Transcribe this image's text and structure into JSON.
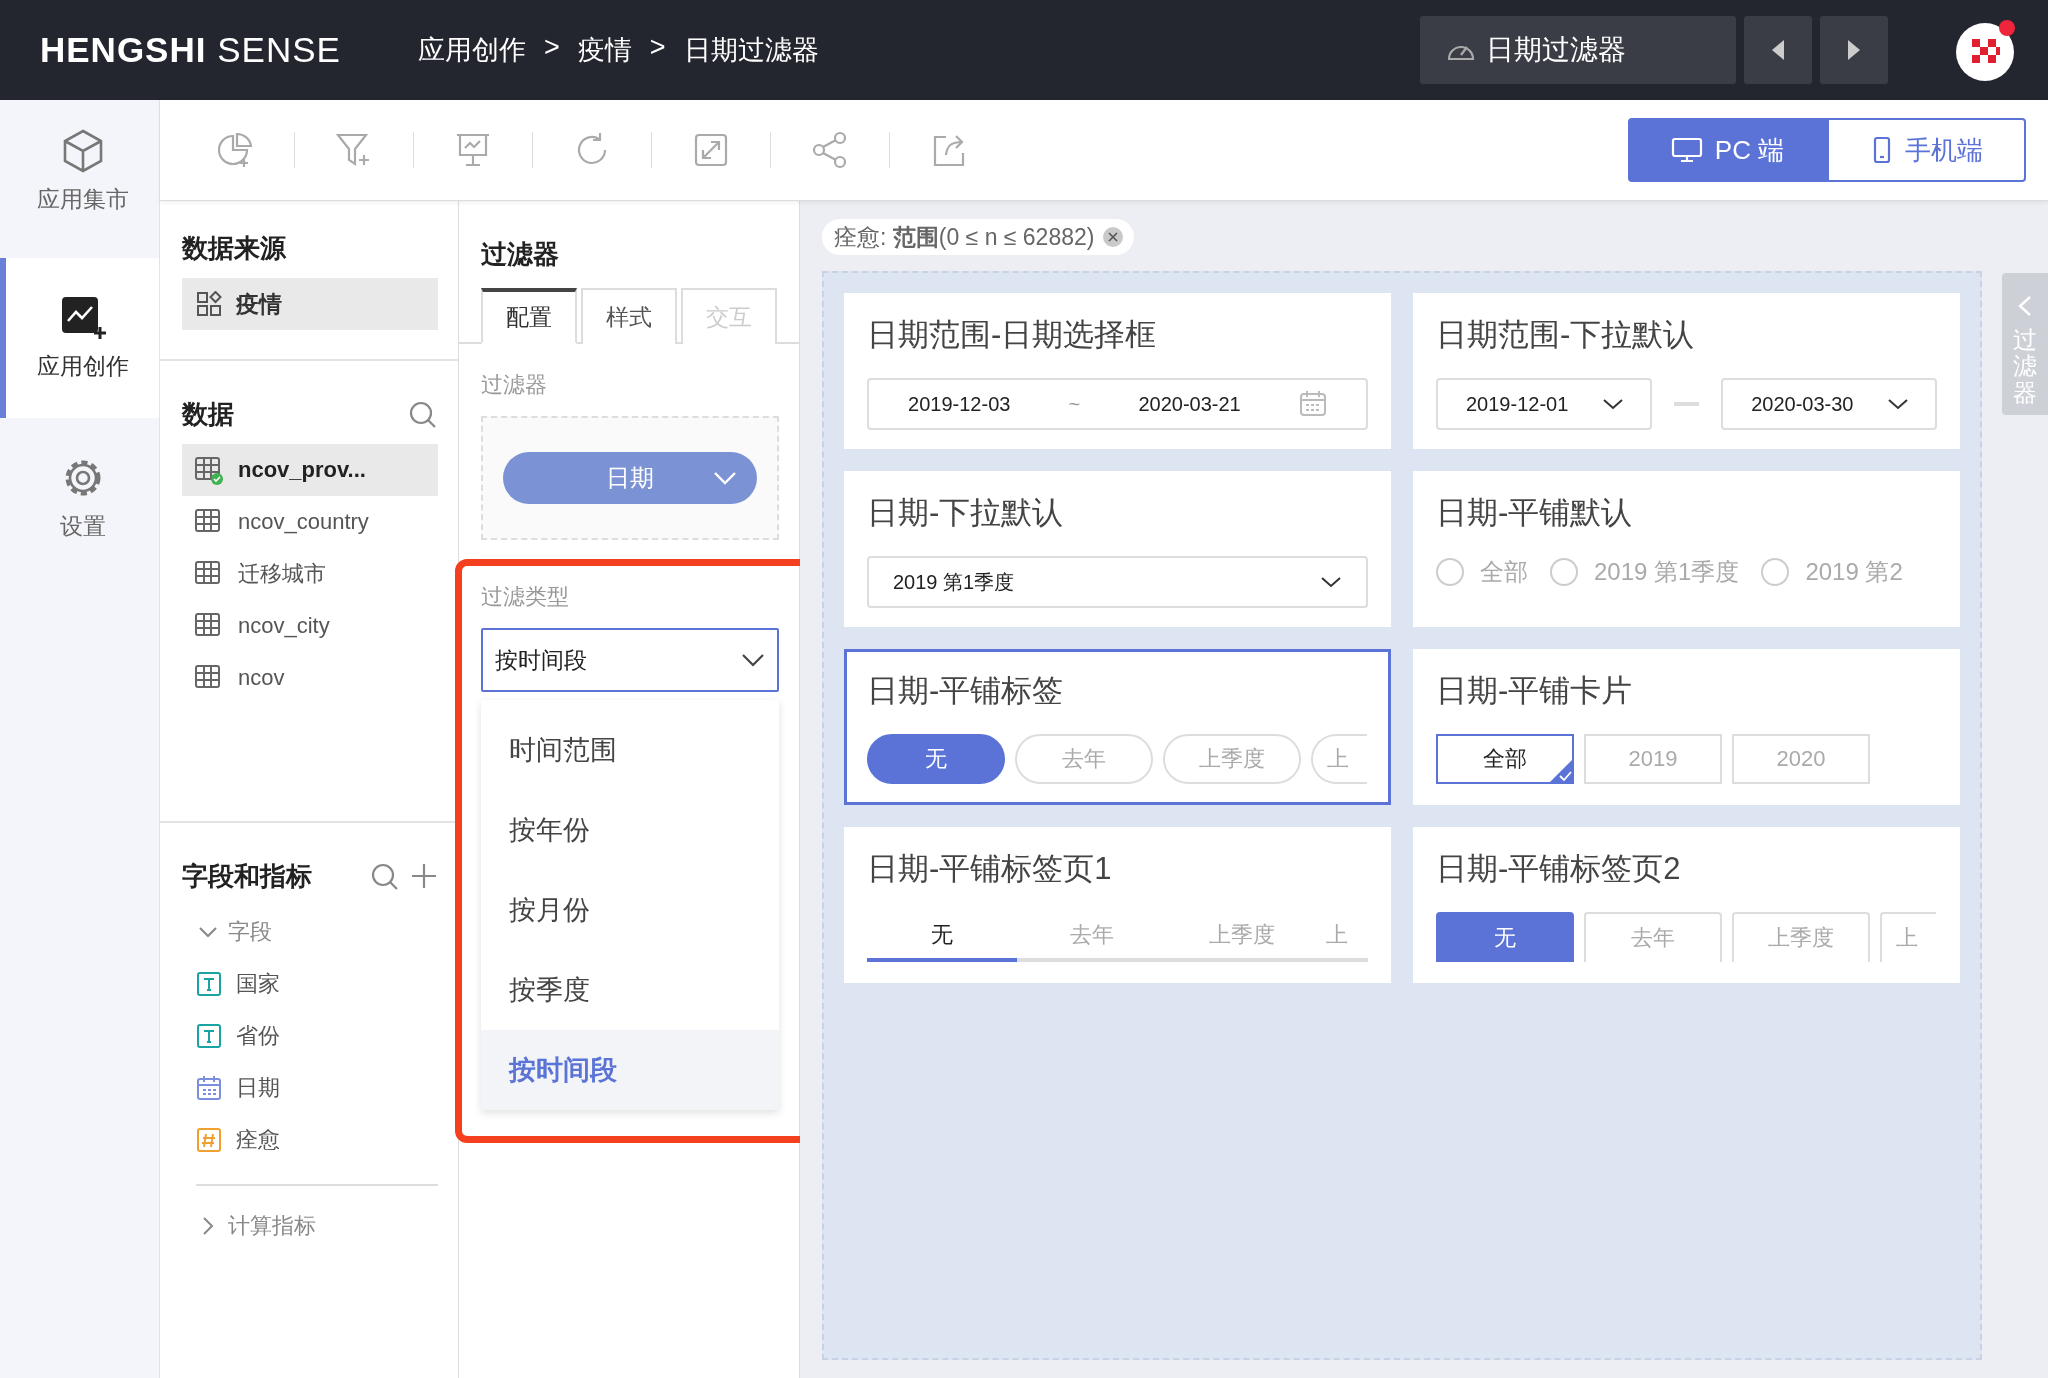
{
  "top_bar": {
    "brand_bold": "HENGSHI",
    "brand_light": "SENSE",
    "breadcrumb": [
      "应用创作",
      ">",
      "疫情",
      ">",
      "日期过滤器"
    ],
    "dashboard_switch": "日期过滤器"
  },
  "nav": [
    {
      "label": "应用集市",
      "kind": "market",
      "selected": false
    },
    {
      "label": "应用创作",
      "kind": "create",
      "selected": true
    },
    {
      "label": "设置",
      "kind": "settings",
      "selected": false
    }
  ],
  "view_toggle": [
    {
      "label": "PC 端",
      "kind": "pc",
      "selected": true
    },
    {
      "label": "手机端",
      "kind": "mobile",
      "selected": false
    }
  ],
  "data_source": {
    "title": "数据来源",
    "item": "疫情"
  },
  "data": {
    "title": "数据",
    "tables": [
      {
        "name": "ncov_prov...",
        "selected": true
      },
      {
        "name": "ncov_country",
        "selected": false
      },
      {
        "name": "迁移城市",
        "selected": false
      },
      {
        "name": "ncov_city",
        "selected": false
      },
      {
        "name": "ncov",
        "selected": false
      }
    ]
  },
  "fields": {
    "title": "字段和指标",
    "groups": [
      {
        "label": "字段",
        "expanded": true,
        "children": [
          {
            "name": "国家",
            "kind": "text"
          },
          {
            "name": "省份",
            "kind": "text"
          },
          {
            "name": "日期",
            "kind": "date"
          },
          {
            "name": "痊愈",
            "kind": "number"
          }
        ]
      },
      {
        "label": "计算指标",
        "expanded": false
      }
    ]
  },
  "filter_panel": {
    "title": "过滤器",
    "tabs": [
      {
        "label": "配置",
        "selected": true,
        "disabled": false
      },
      {
        "label": "样式",
        "selected": false,
        "disabled": false
      },
      {
        "label": "交互",
        "selected": false,
        "disabled": true
      }
    ],
    "filter_label": "过滤器",
    "filter_pill": "日期",
    "type_label": "过滤类型",
    "type_value": "按时间段",
    "options": [
      {
        "label": "时间范围",
        "selected": false
      },
      {
        "label": "按年份",
        "selected": false
      },
      {
        "label": "按月份",
        "selected": false
      },
      {
        "label": "按季度",
        "selected": false
      },
      {
        "label": "按时间段",
        "selected": true
      }
    ]
  },
  "canvas": {
    "chip": "痊愈: **范围**(0 ≤ n ≤ 62882)",
    "side_tab": "过滤器",
    "cards": [
      {
        "title": "日期范围-日期选择框",
        "kind": "picker",
        "selected": false,
        "start": "2019-12-03",
        "separator": "~",
        "end": "2020-03-21"
      },
      {
        "title": "日期范围-下拉默认",
        "kind": "range-select",
        "selected": false,
        "start": "2019-12-01",
        "end": "2020-03-30"
      },
      {
        "title": "日期-下拉默认",
        "kind": "select",
        "selected": false,
        "value": "2019 第1季度"
      },
      {
        "title": "日期-平铺默认",
        "kind": "radio",
        "selected": false,
        "options": [
          {
            "label": "全部",
            "selected": false
          },
          {
            "label": "2019 第1季度",
            "selected": false
          },
          {
            "label": "2019 第2",
            "selected": false
          }
        ]
      },
      {
        "title": "日期-平铺标签",
        "kind": "pills",
        "selected": true,
        "options": [
          {
            "label": "无",
            "selected": true
          },
          {
            "label": "去年",
            "selected": false
          },
          {
            "label": "上季度",
            "selected": false
          },
          {
            "label": "上",
            "selected": false
          }
        ]
      },
      {
        "title": "日期-平铺卡片",
        "kind": "tiles",
        "selected": false,
        "options": [
          {
            "label": "全部",
            "selected": true
          },
          {
            "label": "2019",
            "selected": false
          },
          {
            "label": "2020",
            "selected": false
          }
        ]
      },
      {
        "title": "日期-平铺标签页1",
        "kind": "tab-line",
        "selected": false,
        "options": [
          {
            "label": "无",
            "selected": true
          },
          {
            "label": "去年",
            "selected": false
          },
          {
            "label": "上季度",
            "selected": false
          },
          {
            "label": "上",
            "selected": false
          }
        ]
      },
      {
        "title": "日期-平铺标签页2",
        "kind": "tab-box",
        "selected": false,
        "options": [
          {
            "label": "无",
            "selected": true
          },
          {
            "label": "去年",
            "selected": false
          },
          {
            "label": "上季度",
            "selected": false
          },
          {
            "label": "上",
            "selected": false
          }
        ]
      }
    ]
  }
}
